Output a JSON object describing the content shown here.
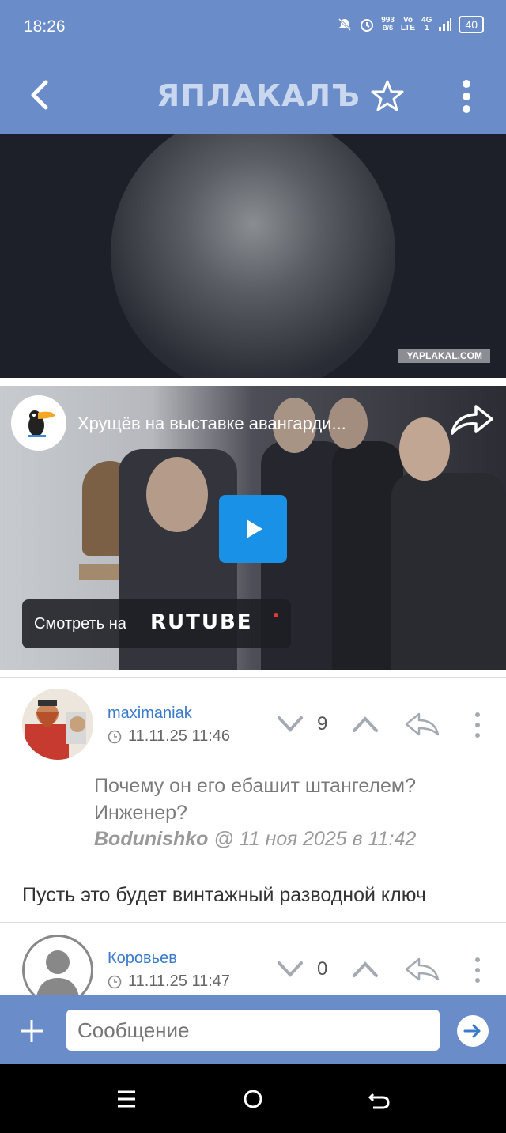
{
  "status_bar": {
    "time": "18:26",
    "net_speed_value": "993",
    "net_speed_unit": "B/S",
    "volte_top": "Vo",
    "volte_bottom": "LTE",
    "signal_top": "4G",
    "signal_bottom": "1",
    "battery": "40"
  },
  "app_bar": {
    "logo": "ЯПЛАКАЛЪ"
  },
  "video1": {
    "watermark": "YAPLAKAL.COM"
  },
  "embed": {
    "title": "Хрущёв на выставке авангарди...",
    "watch_label": "Смотреть на",
    "brand": "RUTUBE"
  },
  "comments": [
    {
      "username": "maximaniak",
      "timestamp": "11.11.25 11:46",
      "score": "9",
      "quote_text": "Почему он его ебашит штангелем? Инженер?",
      "quote_author": "Bodunishko",
      "quote_meta": "@ 11 ноя 2025 в 11:42",
      "body": "Пусть это будет винтажный разводной ключ"
    },
    {
      "username": "Коровьев",
      "timestamp": "11.11.25 11:47",
      "score": "0"
    }
  ],
  "input": {
    "placeholder": "Сообщение"
  },
  "colors": {
    "header": "#6a8cc8",
    "link": "#3b79c9",
    "play": "#1891e6"
  }
}
